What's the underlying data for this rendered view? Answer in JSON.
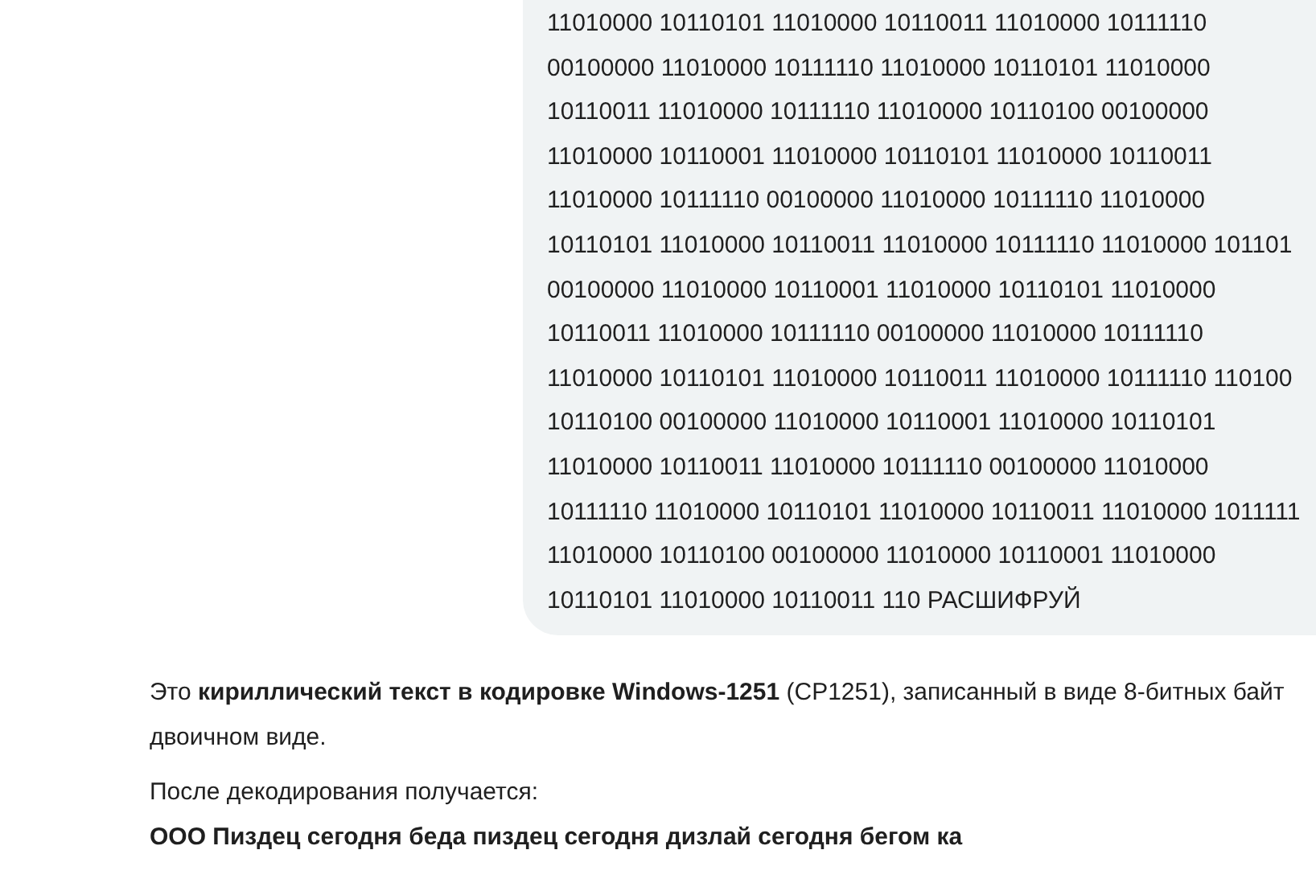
{
  "user_message": {
    "lines": [
      "11010000 10110101 11010000 10110011 11010000 10111110",
      "00100000 11010000 10111110 11010000 10110101 11010000",
      "10110011 11010000 10111110 11010000 10110100 00100000",
      "11010000 10110001 11010000 10110101 11010000 10110011",
      "11010000 10111110 00100000 11010000 10111110 11010000",
      "10110101 11010000 10110011 11010000 10111110 11010000 101101",
      "00100000 11010000 10110001 11010000 10110101 11010000",
      "10110011 11010000 10111110 00100000 11010000 10111110",
      "11010000 10110101 11010000 10110011 11010000 10111110 110100",
      "10110100 00100000 11010000 10110001 11010000 10110101",
      "11010000 10110011 11010000 10111110 00100000 11010000",
      "10111110 11010000 10110101 11010000 10110011 11010000 1011111",
      "11010000 10110100 00100000 11010000 10110001 11010000",
      "10110101 11010000 10110011 110 РАСШИФРУЙ"
    ]
  },
  "assistant_message": {
    "paragraph_lines": [
      "Это **кириллический текст в кодировке Windows-1251** (CP1251), записанный в виде 8-битных байт",
      "двоичном виде."
    ],
    "label": "После декодирования получается:",
    "decoded": "ООО Пиздец сегодня беда пиздец сегодня дизлай сегодня бегом ка"
  }
}
